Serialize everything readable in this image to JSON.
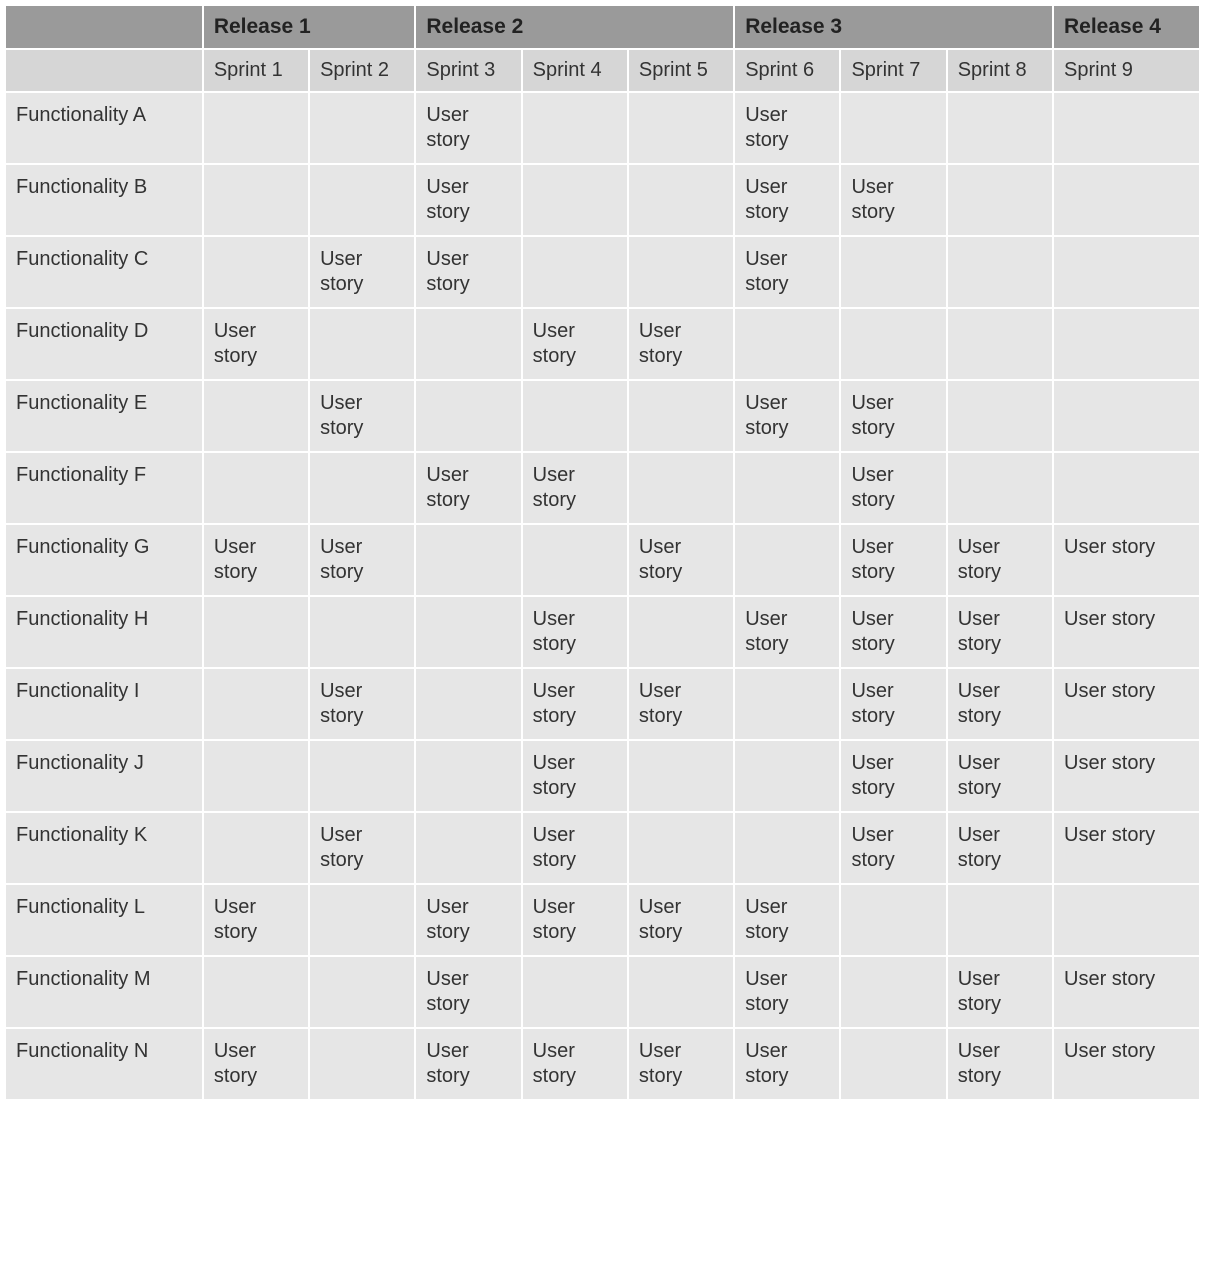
{
  "releases": [
    {
      "label": "Release 1",
      "span": 2
    },
    {
      "label": "Release 2",
      "span": 3
    },
    {
      "label": "Release 3",
      "span": 3
    },
    {
      "label": "Release 4",
      "span": 1
    }
  ],
  "sprints": [
    "Sprint 1",
    "Sprint 2",
    "Sprint 3",
    "Sprint 4",
    "Sprint 5",
    "Sprint 6",
    "Sprint 7",
    "Sprint 8",
    "Sprint 9"
  ],
  "cell_label": "User story",
  "rows": [
    {
      "name": "Functionality A",
      "cells": [
        0,
        0,
        1,
        0,
        0,
        1,
        0,
        0,
        0
      ]
    },
    {
      "name": "Functionality B",
      "cells": [
        0,
        0,
        1,
        0,
        0,
        1,
        1,
        0,
        0
      ]
    },
    {
      "name": "Functionality C",
      "cells": [
        0,
        1,
        1,
        0,
        0,
        1,
        0,
        0,
        0
      ]
    },
    {
      "name": "Functionality D",
      "cells": [
        1,
        0,
        0,
        1,
        1,
        0,
        0,
        0,
        0
      ]
    },
    {
      "name": "Functionality E",
      "cells": [
        0,
        1,
        0,
        0,
        0,
        1,
        1,
        0,
        0
      ]
    },
    {
      "name": "Functionality F",
      "cells": [
        0,
        0,
        1,
        1,
        0,
        0,
        1,
        0,
        0
      ]
    },
    {
      "name": "Functionality G",
      "cells": [
        1,
        1,
        0,
        0,
        1,
        0,
        1,
        1,
        1
      ]
    },
    {
      "name": "Functionality H",
      "cells": [
        0,
        0,
        0,
        1,
        0,
        1,
        1,
        1,
        1
      ]
    },
    {
      "name": "Functionality I",
      "cells": [
        0,
        1,
        0,
        1,
        1,
        0,
        1,
        1,
        1
      ]
    },
    {
      "name": "Functionality J",
      "cells": [
        0,
        0,
        0,
        1,
        0,
        0,
        1,
        1,
        1
      ]
    },
    {
      "name": "Functionality K",
      "cells": [
        0,
        1,
        0,
        1,
        0,
        0,
        1,
        1,
        1
      ]
    },
    {
      "name": "Functionality L",
      "cells": [
        1,
        0,
        1,
        1,
        1,
        1,
        0,
        0,
        0
      ]
    },
    {
      "name": "Functionality M",
      "cells": [
        0,
        0,
        1,
        0,
        0,
        1,
        0,
        1,
        1
      ]
    },
    {
      "name": "Functionality N",
      "cells": [
        1,
        0,
        1,
        1,
        1,
        1,
        0,
        1,
        1
      ]
    }
  ]
}
